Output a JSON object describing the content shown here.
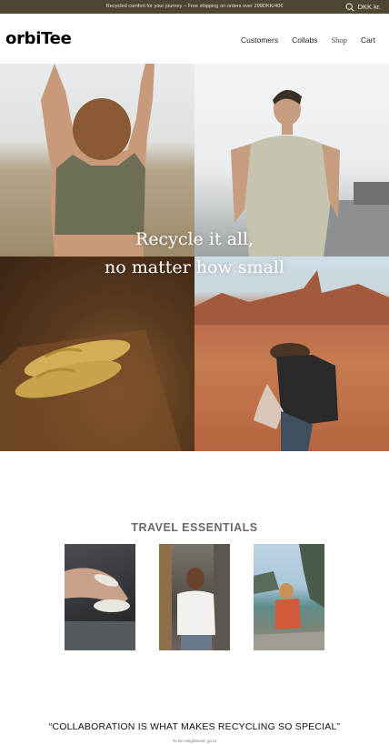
{
  "announcement": {
    "message": "Recycled comfort for your journey – Free shipping on orders over 299DKK/40€",
    "currency_label": "DKK kr.",
    "search_icon": "search-icon"
  },
  "header": {
    "logo": "orbiTee",
    "nav": [
      {
        "label": "Customers"
      },
      {
        "label": "Collabs"
      },
      {
        "label": "Shop"
      },
      {
        "label": "Cart"
      }
    ]
  },
  "hero": {
    "line1": "Recycle it all,",
    "line2": "no matter how small"
  },
  "travel": {
    "title": "TRAVEL ESSENTIALS"
  },
  "collab": {
    "quote": "“COLLABORATION IS WHAT MAKES RECYCLING SO SPECIAL”",
    "sub": "To be enlightened, go to"
  },
  "colors": {
    "announcement_bg": "#4d4633",
    "accent": "#000000"
  }
}
